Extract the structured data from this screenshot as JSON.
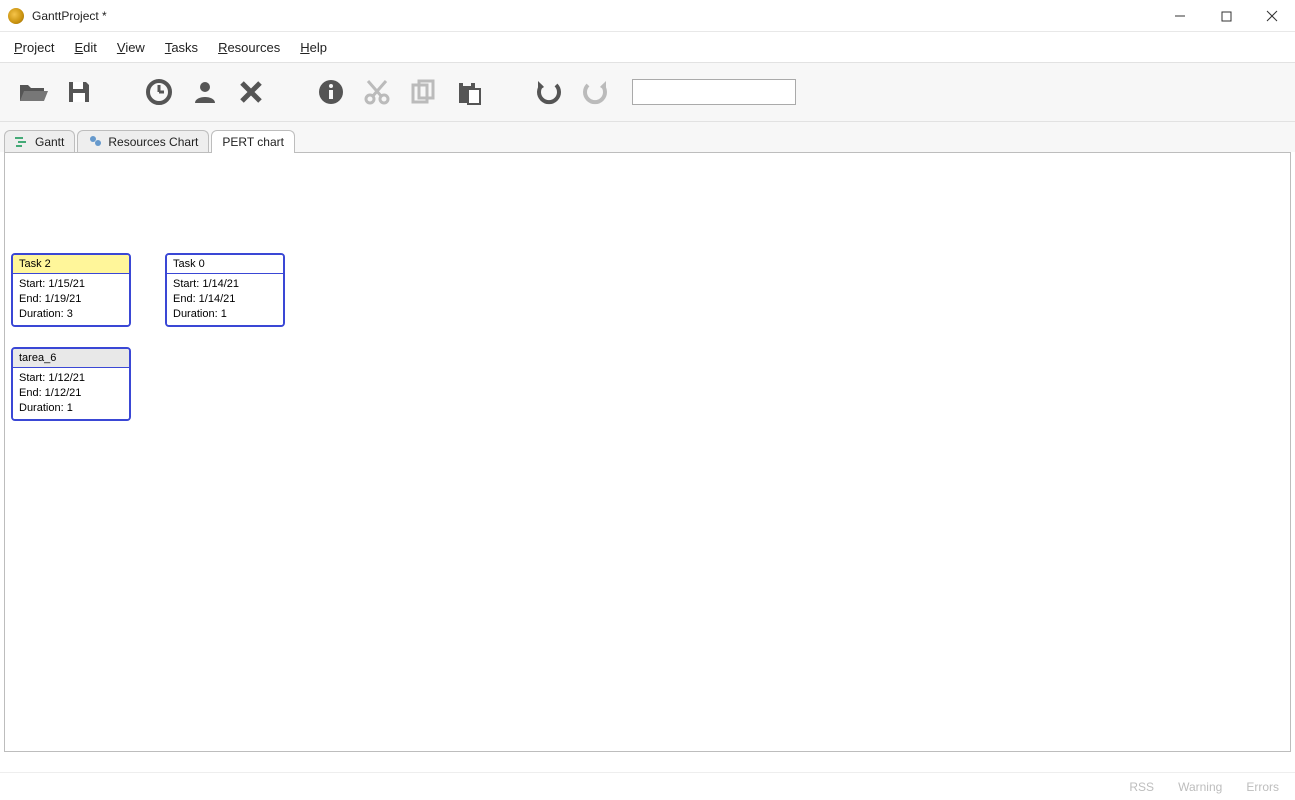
{
  "window": {
    "title": "GanttProject *"
  },
  "menu": {
    "project": "Project",
    "edit": "Edit",
    "view": "View",
    "tasks": "Tasks",
    "resources": "Resources",
    "help": "Help"
  },
  "toolbar": {
    "search_value": ""
  },
  "tabs": {
    "gantt": "Gantt",
    "resources_chart": "Resources Chart",
    "pert_chart": "PERT chart"
  },
  "pert": {
    "nodes": [
      {
        "id": "task2",
        "title": "Task 2",
        "start": "Start: 1/15/21",
        "end": "End: 1/19/21",
        "duration": "Duration: 3"
      },
      {
        "id": "task0",
        "title": "Task 0",
        "start": "Start: 1/14/21",
        "end": "End: 1/14/21",
        "duration": "Duration: 1"
      },
      {
        "id": "tarea6",
        "title": "tarea_6",
        "start": "Start: 1/12/21",
        "end": "End: 1/12/21",
        "duration": "Duration: 1"
      }
    ]
  },
  "status": {
    "rss": "RSS",
    "warning": "Warning",
    "errors": "Errors"
  }
}
